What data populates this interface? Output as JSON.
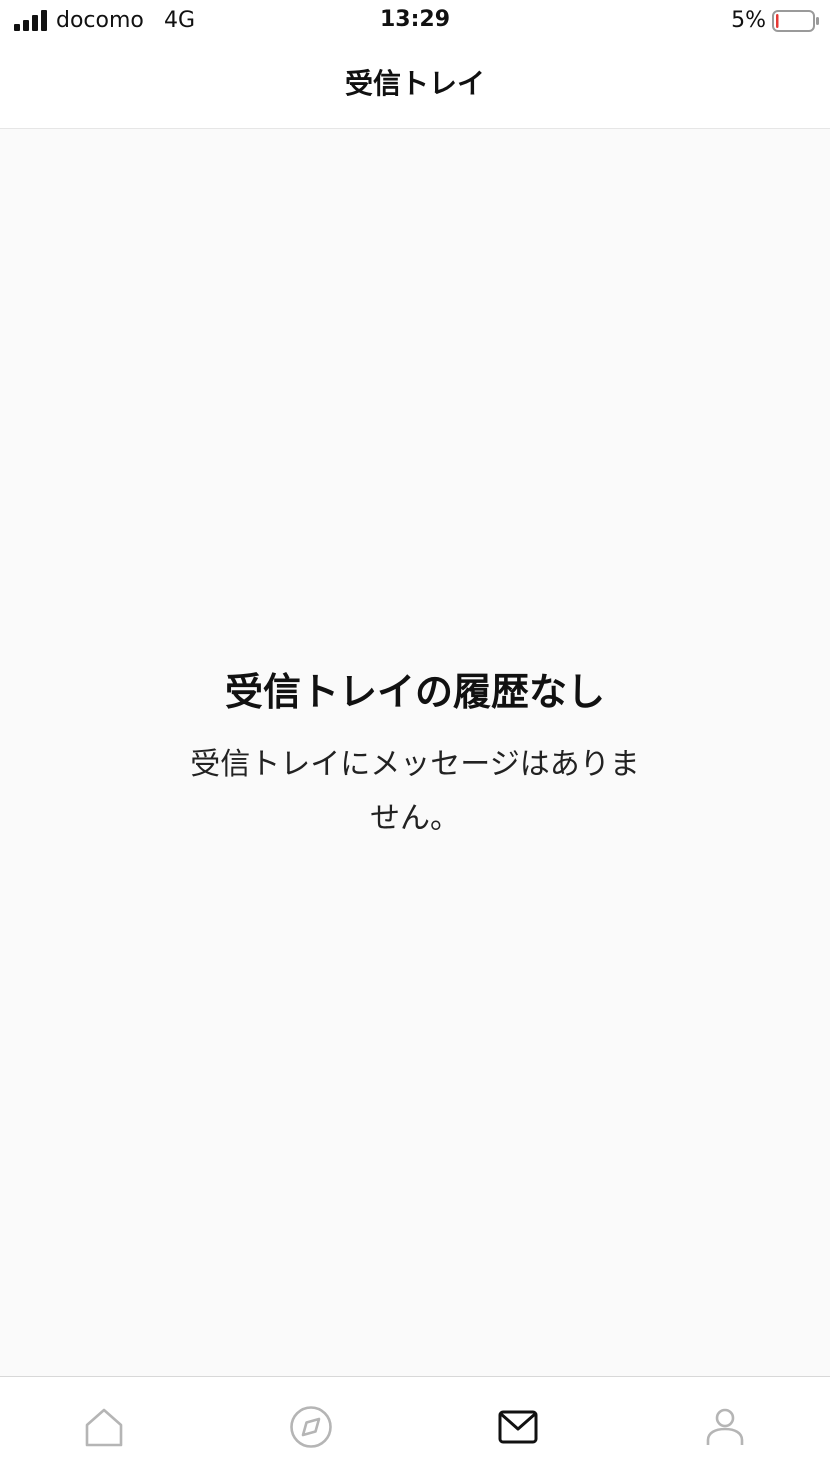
{
  "status_bar": {
    "carrier": "docomo",
    "network": "4G",
    "time": "13:29",
    "battery_percent": "5%",
    "battery_level": 0.05,
    "battery_low_color": "#e53935"
  },
  "nav": {
    "title": "受信トレイ"
  },
  "empty_state": {
    "title": "受信トレイの履歴なし",
    "message": "受信トレイにメッセージはありません。"
  },
  "tab_bar": {
    "items": [
      {
        "icon": "home-icon",
        "selected": false
      },
      {
        "icon": "compass-icon",
        "selected": false
      },
      {
        "icon": "mail-icon",
        "selected": true
      },
      {
        "icon": "profile-icon",
        "selected": false
      }
    ],
    "selected_color": "#111111",
    "unselected_color": "#b5b5b5"
  }
}
